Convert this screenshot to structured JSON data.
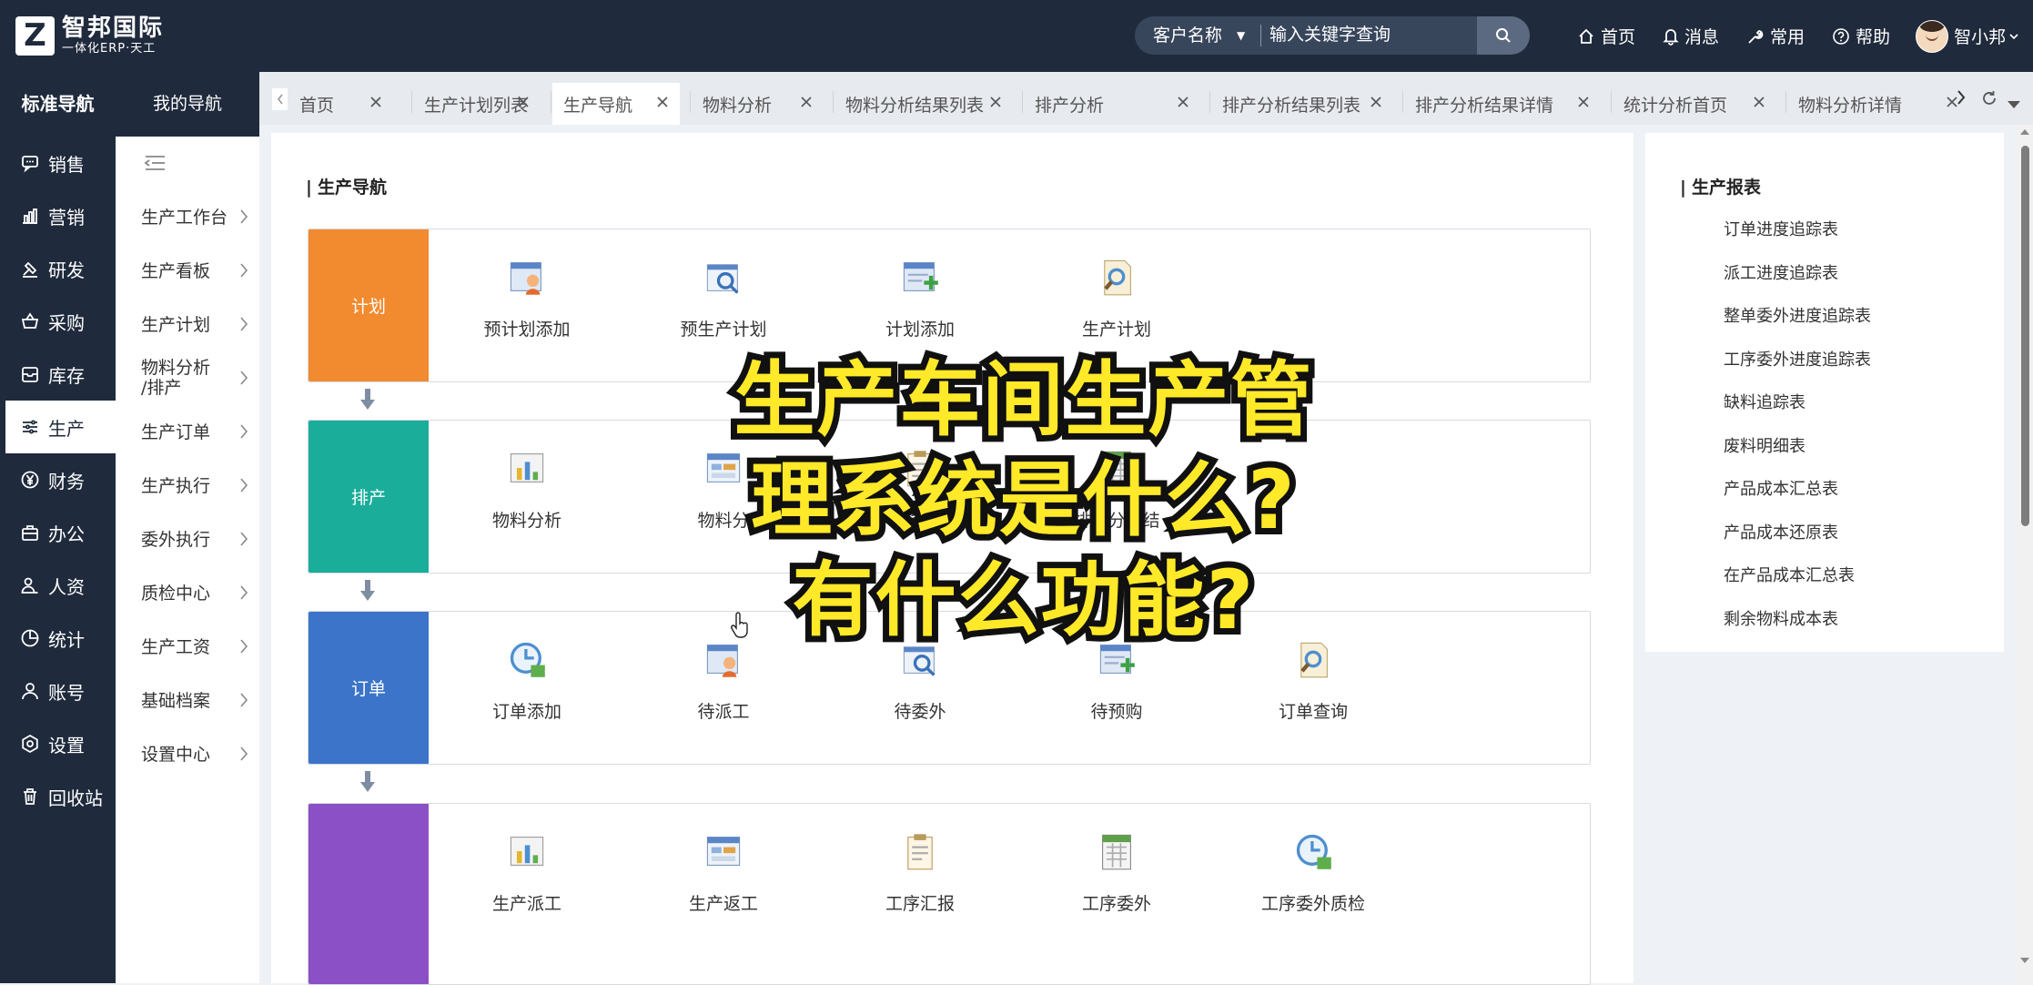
{
  "app": {
    "logo_letter": "Z",
    "name": "智邦国际",
    "tagline": "一体化ERP·天工"
  },
  "search": {
    "field_selected": "客户名称",
    "placeholder": "输入关键字查询"
  },
  "top_links": {
    "home": "首页",
    "messages": "消息",
    "common": "常用",
    "help": "帮助",
    "user": "智小邦"
  },
  "nav": {
    "standard_label": "标准导航",
    "my_label": "我的导航",
    "primary": [
      {
        "label": "销售",
        "icon": "chat-icon"
      },
      {
        "label": "营销",
        "icon": "bar-chart-icon"
      },
      {
        "label": "研发",
        "icon": "research-icon"
      },
      {
        "label": "采购",
        "icon": "basket-icon"
      },
      {
        "label": "库存",
        "icon": "inventory-icon"
      },
      {
        "label": "生产",
        "icon": "production-icon"
      },
      {
        "label": "财务",
        "icon": "yen-icon"
      },
      {
        "label": "办公",
        "icon": "briefcase-icon"
      },
      {
        "label": "人资",
        "icon": "people-icon"
      },
      {
        "label": "统计",
        "icon": "pie-chart-icon"
      },
      {
        "label": "账号",
        "icon": "user-icon"
      },
      {
        "label": "设置",
        "icon": "settings-icon"
      },
      {
        "label": "回收站",
        "icon": "trash-icon"
      }
    ],
    "active_primary": "生产",
    "secondary": [
      "生产工作台",
      "生产看板",
      "生产计划",
      "物料分析\n/排产",
      "生产订单",
      "生产执行",
      "委外执行",
      "质检中心",
      "生产工资",
      "基础档案",
      "设置中心"
    ]
  },
  "tabs": [
    {
      "label": "首页"
    },
    {
      "label": "生产计划列表"
    },
    {
      "label": "生产导航",
      "active": true
    },
    {
      "label": "物料分析"
    },
    {
      "label": "物料分析结果列表"
    },
    {
      "label": "排产分析"
    },
    {
      "label": "排产分析结果列表"
    },
    {
      "label": "排产分析结果详情"
    },
    {
      "label": "统计分析首页"
    },
    {
      "label": "物料分析详情"
    }
  ],
  "main": {
    "title": "生产导航",
    "rows": [
      {
        "label": "计划",
        "color": "#f28a30",
        "items": [
          "预计划添加",
          "预生产计划",
          "计划添加",
          "生产计划"
        ]
      },
      {
        "label": "排产",
        "color": "#1aad9a",
        "items": [
          "物料分析",
          "物料分",
          "",
          "排产分析结"
        ]
      },
      {
        "label": "订单",
        "color": "#3b74c8",
        "items": [
          "订单添加",
          "待派工",
          "待委外",
          "待预购",
          "订单查询"
        ]
      },
      {
        "label": "",
        "color": "#8b4fc6",
        "items": [
          "生产派工",
          "生产返工",
          "工序汇报",
          "工序委外",
          "工序委外质检"
        ]
      }
    ]
  },
  "reports": {
    "title": "生产报表",
    "items": [
      "订单进度追踪表",
      "派工进度追踪表",
      "整单委外进度追踪表",
      "工序委外进度追踪表",
      "缺料追踪表",
      "废料明细表",
      "产品成本汇总表",
      "产品成本还原表",
      "在产品成本汇总表",
      "剩余物料成本表"
    ]
  },
  "overlay": {
    "line1": "生产车间生产管",
    "line2": "理系统是什么?",
    "line3": "有什么功能?"
  }
}
